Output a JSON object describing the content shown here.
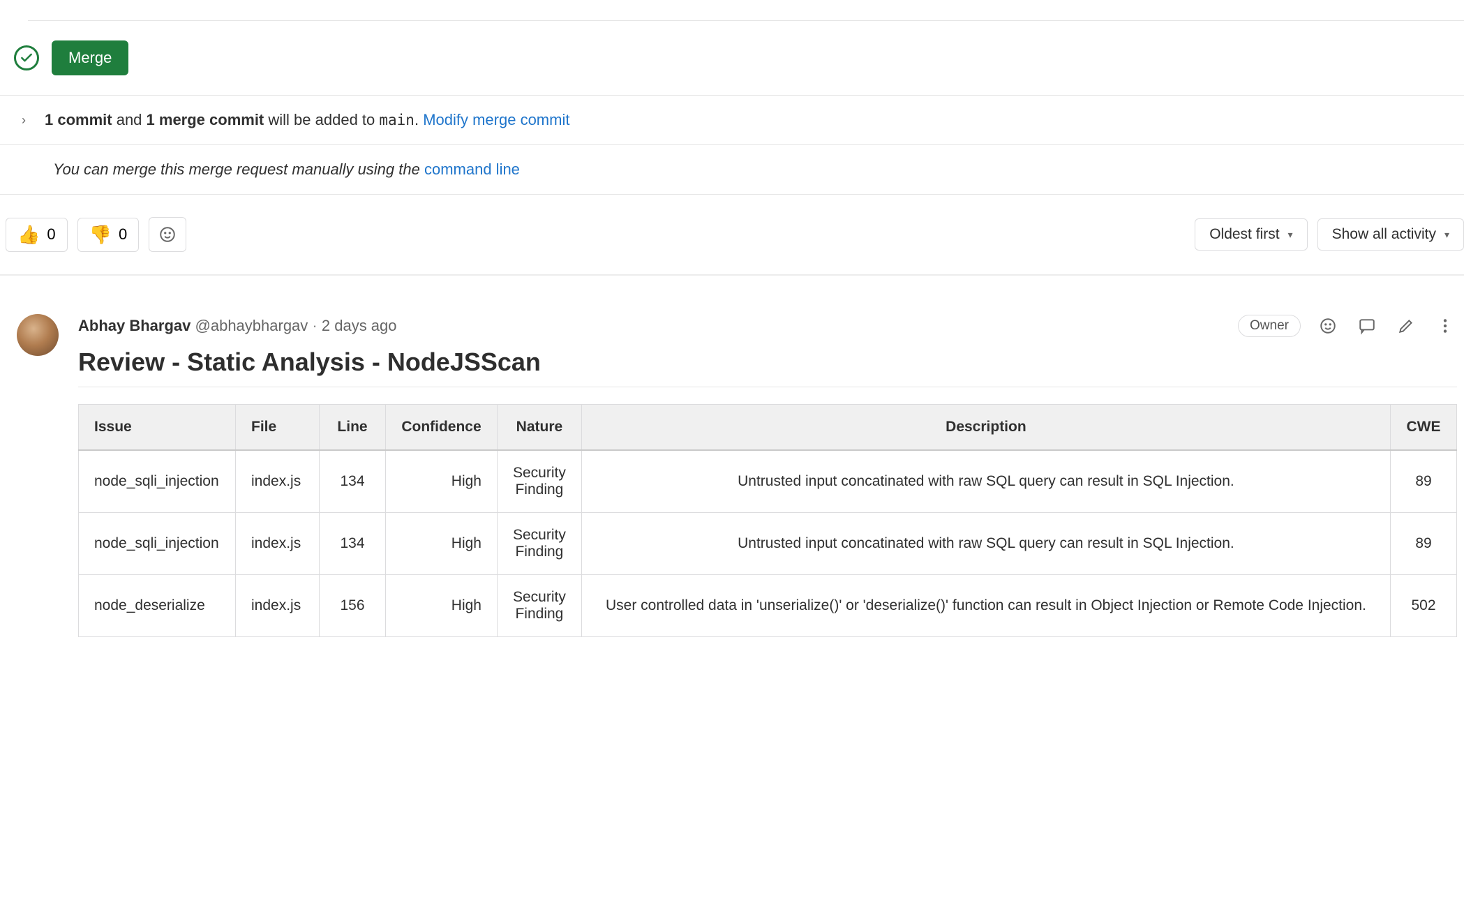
{
  "merge": {
    "button_label": "Merge",
    "commit_count": "1 commit",
    "and_text": " and ",
    "merge_commit_count": "1 merge commit",
    "added_text": " will be added to ",
    "branch": "main",
    "period": ". ",
    "modify_link": "Modify merge commit",
    "manual_prefix": "You can merge this merge request manually using the ",
    "cmdline_link": "command line"
  },
  "reactions": {
    "thumbs_up_count": "0",
    "thumbs_down_count": "0"
  },
  "sort": {
    "order_label": "Oldest first",
    "filter_label": "Show all activity"
  },
  "comment": {
    "author_name": "Abhay Bhargav",
    "author_handle": "@abhaybhargav",
    "timestamp": "2 days ago",
    "owner_badge": "Owner",
    "title": "Review - Static Analysis - NodeJSScan"
  },
  "table": {
    "headers": {
      "issue": "Issue",
      "file": "File",
      "line": "Line",
      "confidence": "Confidence",
      "nature": "Nature",
      "description": "Description",
      "cwe": "CWE"
    },
    "rows": [
      {
        "issue": "node_sqli_injection",
        "file": "index.js",
        "line": "134",
        "confidence": "High",
        "nature": "Security Finding",
        "description": "Untrusted input concatinated with raw SQL query can result in SQL Injection.",
        "cwe": "89"
      },
      {
        "issue": "node_sqli_injection",
        "file": "index.js",
        "line": "134",
        "confidence": "High",
        "nature": "Security Finding",
        "description": "Untrusted input concatinated with raw SQL query can result in SQL Injection.",
        "cwe": "89"
      },
      {
        "issue": "node_deserialize",
        "file": "index.js",
        "line": "156",
        "confidence": "High",
        "nature": "Security Finding",
        "description": "User controlled data in 'unserialize()' or 'deserialize()' function can result in Object Injection or Remote Code Injection.",
        "cwe": "502"
      }
    ]
  }
}
